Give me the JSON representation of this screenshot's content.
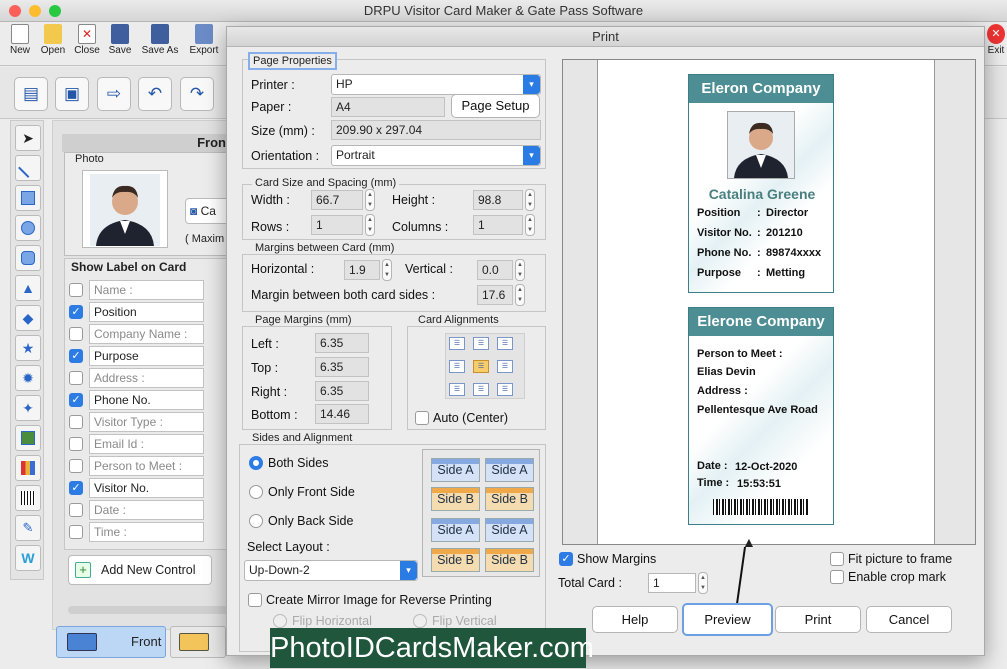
{
  "app": {
    "title": "DRPU Visitor Card Maker & Gate Pass Software"
  },
  "toolbar": {
    "items": [
      {
        "label": "New",
        "icon": "new-file-icon"
      },
      {
        "label": "Open",
        "icon": "open-folder-icon"
      },
      {
        "label": "Close",
        "icon": "close-file-icon"
      },
      {
        "label": "Save",
        "icon": "save-icon"
      },
      {
        "label": "Save As",
        "icon": "save-as-icon"
      },
      {
        "label": "Export",
        "icon": "export-icon"
      }
    ],
    "exit_label": "Exit"
  },
  "main": {
    "front_header": "Fron",
    "photo_label": "Photo",
    "camera_label": "Ca",
    "max_label": "( Maxim",
    "show_label_title": "Show Label on Card",
    "labels": [
      {
        "text": "Name :",
        "checked": false
      },
      {
        "text": "Position",
        "checked": true
      },
      {
        "text": "Company Name :",
        "checked": false
      },
      {
        "text": "Purpose",
        "checked": true
      },
      {
        "text": "Address :",
        "checked": false
      },
      {
        "text": "Phone No.",
        "checked": true
      },
      {
        "text": "Visitor Type :",
        "checked": false
      },
      {
        "text": "Email Id :",
        "checked": false
      },
      {
        "text": "Person to Meet :",
        "checked": false
      },
      {
        "text": "Visitor No.",
        "checked": true
      },
      {
        "text": "Date :",
        "checked": false
      },
      {
        "text": "Time :",
        "checked": false
      }
    ],
    "add_control_label": "Add New Control",
    "front_tab": "Front"
  },
  "dialog": {
    "title": "Print",
    "page_properties": {
      "title": "Page Properties",
      "printer_label": "Printer :",
      "printer_value": "HP",
      "paper_label": "Paper :",
      "paper_value": "A4",
      "page_setup_label": "Page Setup",
      "size_label": "Size (mm) :",
      "size_value": "209.90 x 297.04",
      "orientation_label": "Orientation :",
      "orientation_value": "Portrait"
    },
    "card_size": {
      "title": "Card Size and Spacing (mm)",
      "width_label": "Width :",
      "width_value": "66.7",
      "height_label": "Height :",
      "height_value": "98.8",
      "rows_label": "Rows :",
      "rows_value": "1",
      "columns_label": "Columns :",
      "columns_value": "1"
    },
    "margins_between": {
      "title": "Margins between Card (mm)",
      "horizontal_label": "Horizontal :",
      "horizontal_value": "1.9",
      "vertical_label": "Vertical :",
      "vertical_value": "0.0",
      "both_label": "Margin between both card sides :",
      "both_value": "17.6"
    },
    "page_margins": {
      "title": "Page Margins (mm)",
      "left_label": "Left :",
      "left_value": "6.35",
      "top_label": "Top :",
      "top_value": "6.35",
      "right_label": "Right :",
      "right_value": "6.35",
      "bottom_label": "Bottom :",
      "bottom_value": "14.46"
    },
    "card_alignments": {
      "title": "Card Alignments",
      "auto_label": "Auto (Center)"
    },
    "sides": {
      "title": "Sides and Alignment",
      "both_label": "Both Sides",
      "front_label": "Only Front Side",
      "back_label": "Only Back Side",
      "layout_label": "Select Layout :",
      "layout_value": "Up-Down-2",
      "side_a": "Side A",
      "side_b": "Side B",
      "mirror_label": "Create Mirror Image for Reverse Printing",
      "flip_h": "Flip Horizontal",
      "flip_v": "Flip Vertical"
    },
    "show_margins_label": "Show Margins",
    "total_card_label": "Total Card :",
    "total_card_value": "1",
    "fit_label": "Fit picture to frame",
    "crop_label": "Enable crop mark",
    "buttons": {
      "help": "Help",
      "preview": "Preview",
      "print": "Print",
      "cancel": "Cancel"
    }
  },
  "card_front": {
    "company": "Eleron Company",
    "name": "Catalina Greene",
    "rows": [
      {
        "label": "Position",
        "sep": ":",
        "value": "Director"
      },
      {
        "label": "Visitor No.",
        "sep": ":",
        "value": "201210"
      },
      {
        "label": "Phone No.",
        "sep": ":",
        "value": "89874xxxx"
      },
      {
        "label": "Purpose",
        "sep": ":",
        "value": "Metting"
      }
    ]
  },
  "card_back": {
    "company": "Elerone Company",
    "person_label": "Person to Meet :",
    "person_value": "Elias Devin",
    "address_label": "Address :",
    "address_value": "Pellentesque Ave Road",
    "date_label": "Date :",
    "date_value": "12-Oct-2020",
    "time_label": "Time :",
    "time_value": "15:53:51"
  },
  "brand": "PhotoIDCardsMaker.com",
  "colors": {
    "accent": "#2a7be4",
    "card_header": "#4c8e94",
    "brand_bg": "#20563b"
  }
}
